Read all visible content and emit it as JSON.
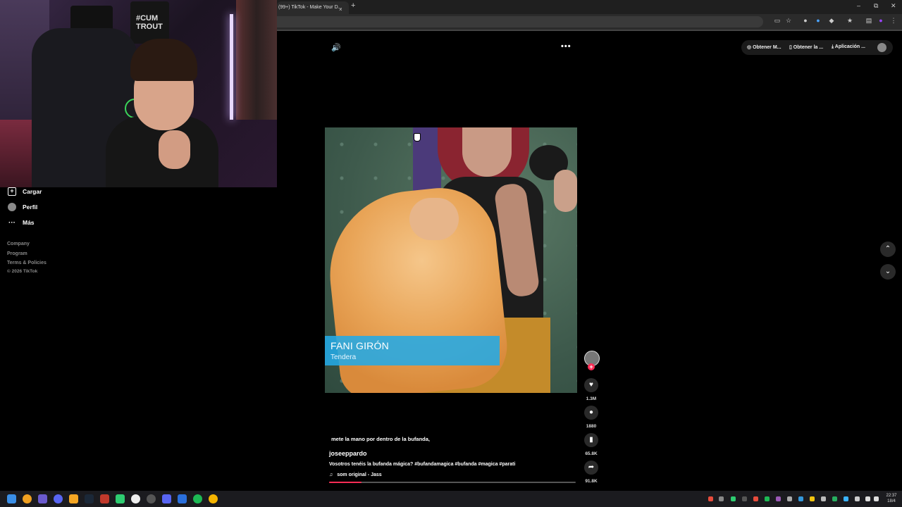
{
  "browser": {
    "tab_title": "(99+) TikTok - Make Your D...",
    "tab_close": "×",
    "new_tab": "+",
    "window_controls": [
      "–",
      "⧉",
      "✕"
    ]
  },
  "sidebar": {
    "items": [
      {
        "label": "Cargar",
        "icon": "upload-icon"
      },
      {
        "label": "Perfil",
        "icon": "avatar"
      },
      {
        "label": "Más",
        "icon": "more-dots-icon"
      }
    ],
    "footer": [
      "Company",
      "Program",
      "Terms & Policies",
      "© 2026 TikTok"
    ]
  },
  "player": {
    "more": "•••",
    "get_bar": [
      {
        "label": "Obtener M...",
        "icon": "coin-icon"
      },
      {
        "label": "Obtener la ...",
        "icon": "phone-icon"
      },
      {
        "label": "Aplicación ...",
        "icon": "download-icon"
      }
    ],
    "video_overlay": {
      "name": "FANI GIRÓN",
      "role": "Tendera"
    },
    "subtitle": "mete la mano por dentro de la bufanda,",
    "username": "joseeppardo",
    "description": "Vosotros tenéis la bufanda mágica? #bufandamagica #bufanda #magica #parati",
    "sound": "som original - Jass",
    "progress": 0.13
  },
  "actions": [
    {
      "name": "like",
      "icon": "heart-icon",
      "count": "1.3M"
    },
    {
      "name": "comment",
      "icon": "comment-icon",
      "count": "1880"
    },
    {
      "name": "bookmark",
      "icon": "bookmark-icon",
      "count": "65.8K"
    },
    {
      "name": "share",
      "icon": "share-icon",
      "count": "91.8K"
    }
  ],
  "follow_badge": "+",
  "webcam": {
    "shirt_text": "#CUM TROUT"
  },
  "clock": {
    "time": "22:37",
    "date": "18/4"
  },
  "colors": {
    "accent": "#fe2c55",
    "overlay_blue": "#23aae6",
    "background": "#000000"
  }
}
